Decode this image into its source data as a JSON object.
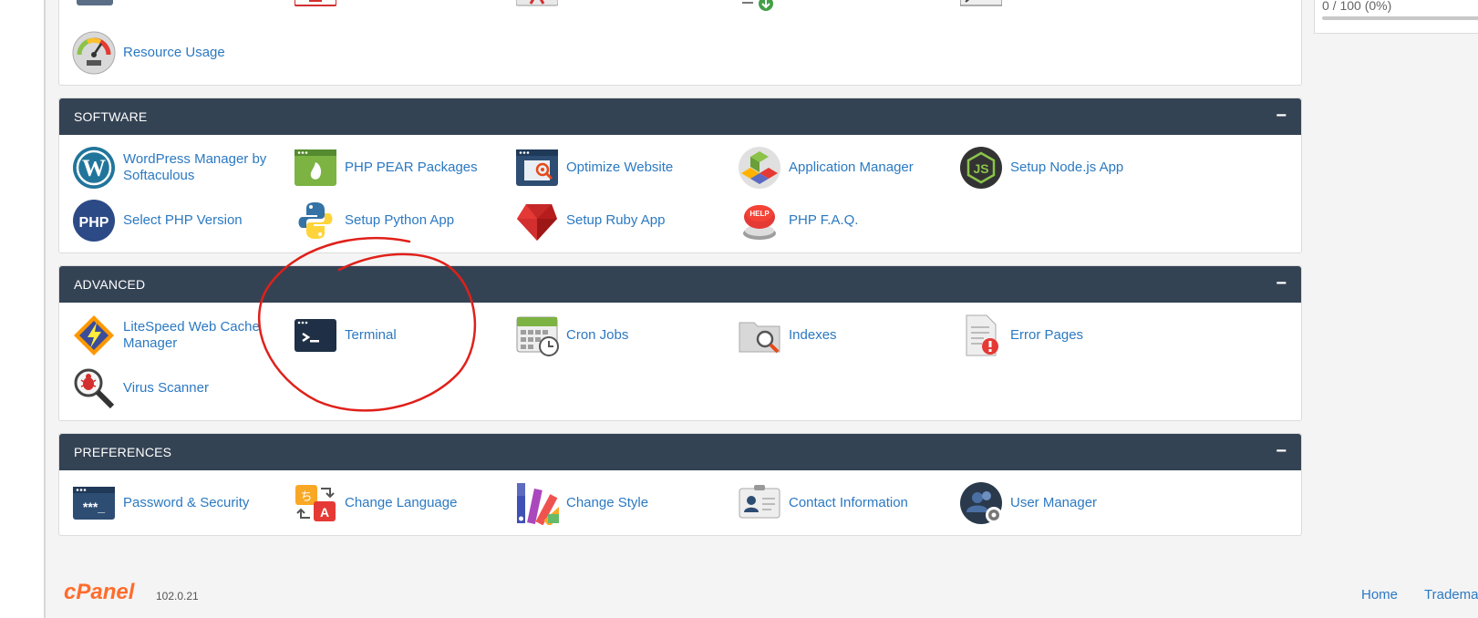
{
  "stats": {
    "usage_text": "0 / 100   (0%)",
    "usage_percent": 0
  },
  "general": {
    "items": [
      {
        "label": "Resource Usage",
        "icon": "gauge-icon"
      }
    ]
  },
  "software": {
    "title": "SOFTWARE",
    "collapse": "−",
    "items": [
      {
        "label": "WordPress Manager by Softaculous",
        "icon": "wordpress-icon"
      },
      {
        "label": "PHP PEAR Packages",
        "icon": "php-pear-icon"
      },
      {
        "label": "Optimize Website",
        "icon": "optimize-website-icon"
      },
      {
        "label": "Application Manager",
        "icon": "application-manager-icon"
      },
      {
        "label": "Setup Node.js App",
        "icon": "nodejs-icon"
      },
      {
        "label": "Select PHP Version",
        "icon": "php-icon"
      },
      {
        "label": "Setup Python App",
        "icon": "python-icon"
      },
      {
        "label": "Setup Ruby App",
        "icon": "ruby-icon"
      },
      {
        "label": "PHP F.A.Q.",
        "icon": "help-button-icon"
      }
    ]
  },
  "advanced": {
    "title": "ADVANCED",
    "collapse": "−",
    "items": [
      {
        "label": "LiteSpeed Web Cache Manager",
        "icon": "litespeed-icon"
      },
      {
        "label": "Terminal",
        "icon": "terminal-icon"
      },
      {
        "label": "Cron Jobs",
        "icon": "cron-calendar-icon"
      },
      {
        "label": "Indexes",
        "icon": "folder-search-icon"
      },
      {
        "label": "Error Pages",
        "icon": "error-page-icon"
      },
      {
        "label": "Virus Scanner",
        "icon": "virus-scanner-icon"
      }
    ]
  },
  "preferences": {
    "title": "PREFERENCES",
    "collapse": "−",
    "items": [
      {
        "label": "Password & Security",
        "icon": "password-icon"
      },
      {
        "label": "Change Language",
        "icon": "language-icon"
      },
      {
        "label": "Change Style",
        "icon": "color-swatch-icon"
      },
      {
        "label": "Contact Information",
        "icon": "contact-card-icon"
      },
      {
        "label": "User Manager",
        "icon": "user-manager-icon"
      }
    ]
  },
  "footer": {
    "logo": "cPanel",
    "version": "102.0.21",
    "links": [
      "Home",
      "Tradema"
    ]
  },
  "colors": {
    "header": "#344354",
    "link": "#2b79c2",
    "brand": "#ff6c2c",
    "annotation": "#e0201a"
  }
}
